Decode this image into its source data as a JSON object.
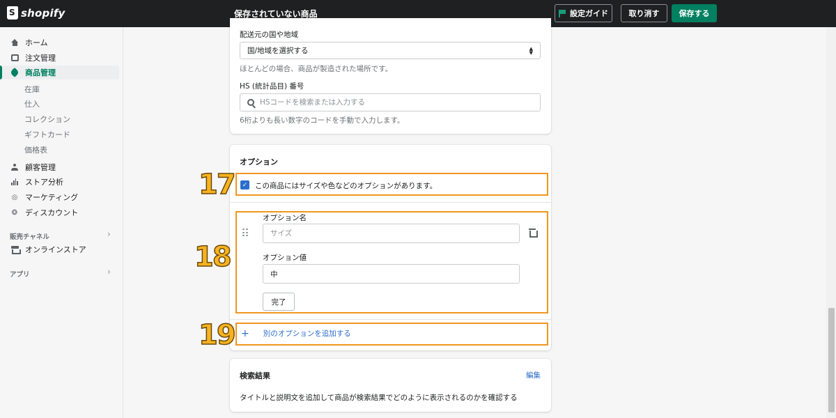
{
  "topbar": {
    "logo_text": "shopify",
    "title": "保存されていない商品",
    "guide_label": "設定ガイド",
    "cancel_label": "取り消す",
    "save_label": "保存する"
  },
  "sidebar": {
    "items": [
      {
        "label": "ホーム"
      },
      {
        "label": "注文管理"
      },
      {
        "label": "商品管理"
      },
      {
        "label": "顧客管理"
      },
      {
        "label": "ストア分析"
      },
      {
        "label": "マーケティング"
      },
      {
        "label": "ディスカウント"
      }
    ],
    "product_sub": [
      "在庫",
      "仕入",
      "コレクション",
      "ギフトカード",
      "価格表"
    ],
    "sales_channel_label": "販売チャネル",
    "online_store_label": "オンラインストア",
    "apps_label": "アプリ"
  },
  "shipping": {
    "origin_label": "配送元の国や地域",
    "origin_select": "国/地域を選択する",
    "origin_help": "ほとんどの場合、商品が製造された場所です。",
    "hs_label": "HS (統計品目) 番号",
    "hs_placeholder": "HSコードを検索または入力する",
    "hs_help": "6桁よりも長い数字のコードを手動で入力します。"
  },
  "options": {
    "title": "オプション",
    "checkbox_label": "この商品にはサイズや色などのオプションがあります。",
    "option_name_label": "オプション名",
    "option_name_placeholder": "サイズ",
    "option_value_label": "オプション値",
    "option_value": "中",
    "done_label": "完了",
    "add_option_label": "別のオプションを追加する"
  },
  "seo": {
    "title": "検索結果",
    "edit_label": "編集",
    "description": "タイトルと説明文を追加して商品が検索結果でどのように表示されるのかを確認する"
  },
  "annotations": {
    "step17": "17",
    "step18": "18",
    "step19": "19"
  },
  "colors": {
    "accent": "#008060",
    "link": "#2c6ecb",
    "highlight": "#f0961e",
    "step_number": "#f7b21e"
  }
}
